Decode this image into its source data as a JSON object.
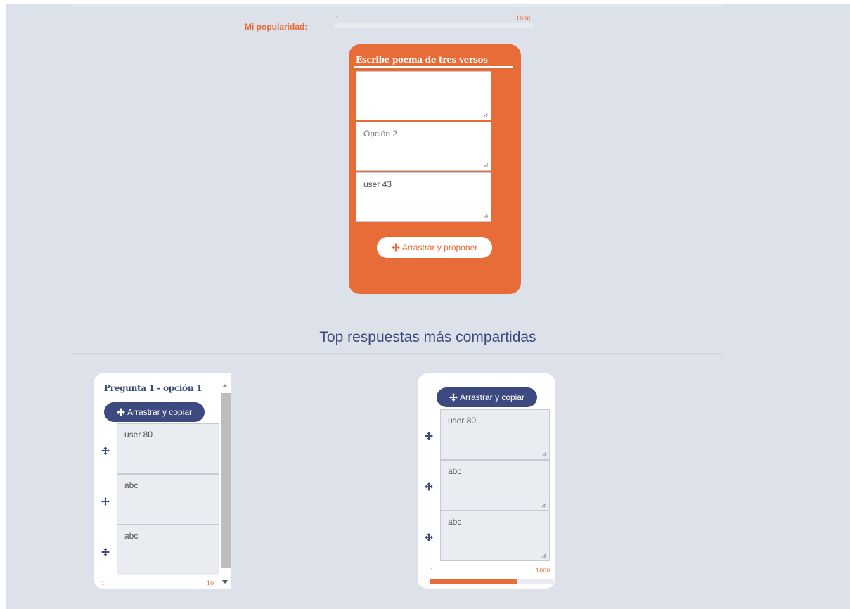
{
  "popularity": {
    "label": "Mi popularidad:",
    "min": "1",
    "max": "1000"
  },
  "poem": {
    "title": "Escribe poema de tres versos",
    "fields": [
      {
        "value": "",
        "placeholder": ""
      },
      {
        "value": "",
        "placeholder": "Opción 2"
      },
      {
        "value": "user 43",
        "placeholder": ""
      }
    ],
    "button_label": "Arrastrar y proponer"
  },
  "top": {
    "heading": "Top respuestas más compartidas"
  },
  "card1": {
    "title": "Pregunta 1 - opción 1",
    "button_label": "Arrastrar y copiar",
    "answers": [
      "user 80",
      "abc",
      "abc"
    ],
    "range_min": "1",
    "range_max": "10"
  },
  "card2": {
    "button_label": "Arrastrar y copiar",
    "answers": [
      "user 80",
      "abc",
      "abc"
    ],
    "range_min": "1",
    "range_max": "1000",
    "progress_fraction": 0.7
  },
  "colors": {
    "accent": "#e86c38",
    "navy": "#3d4a80",
    "background": "#dce1ea"
  },
  "icons": {
    "move": "move-arrows-icon",
    "resize": "resize-grip-icon"
  }
}
